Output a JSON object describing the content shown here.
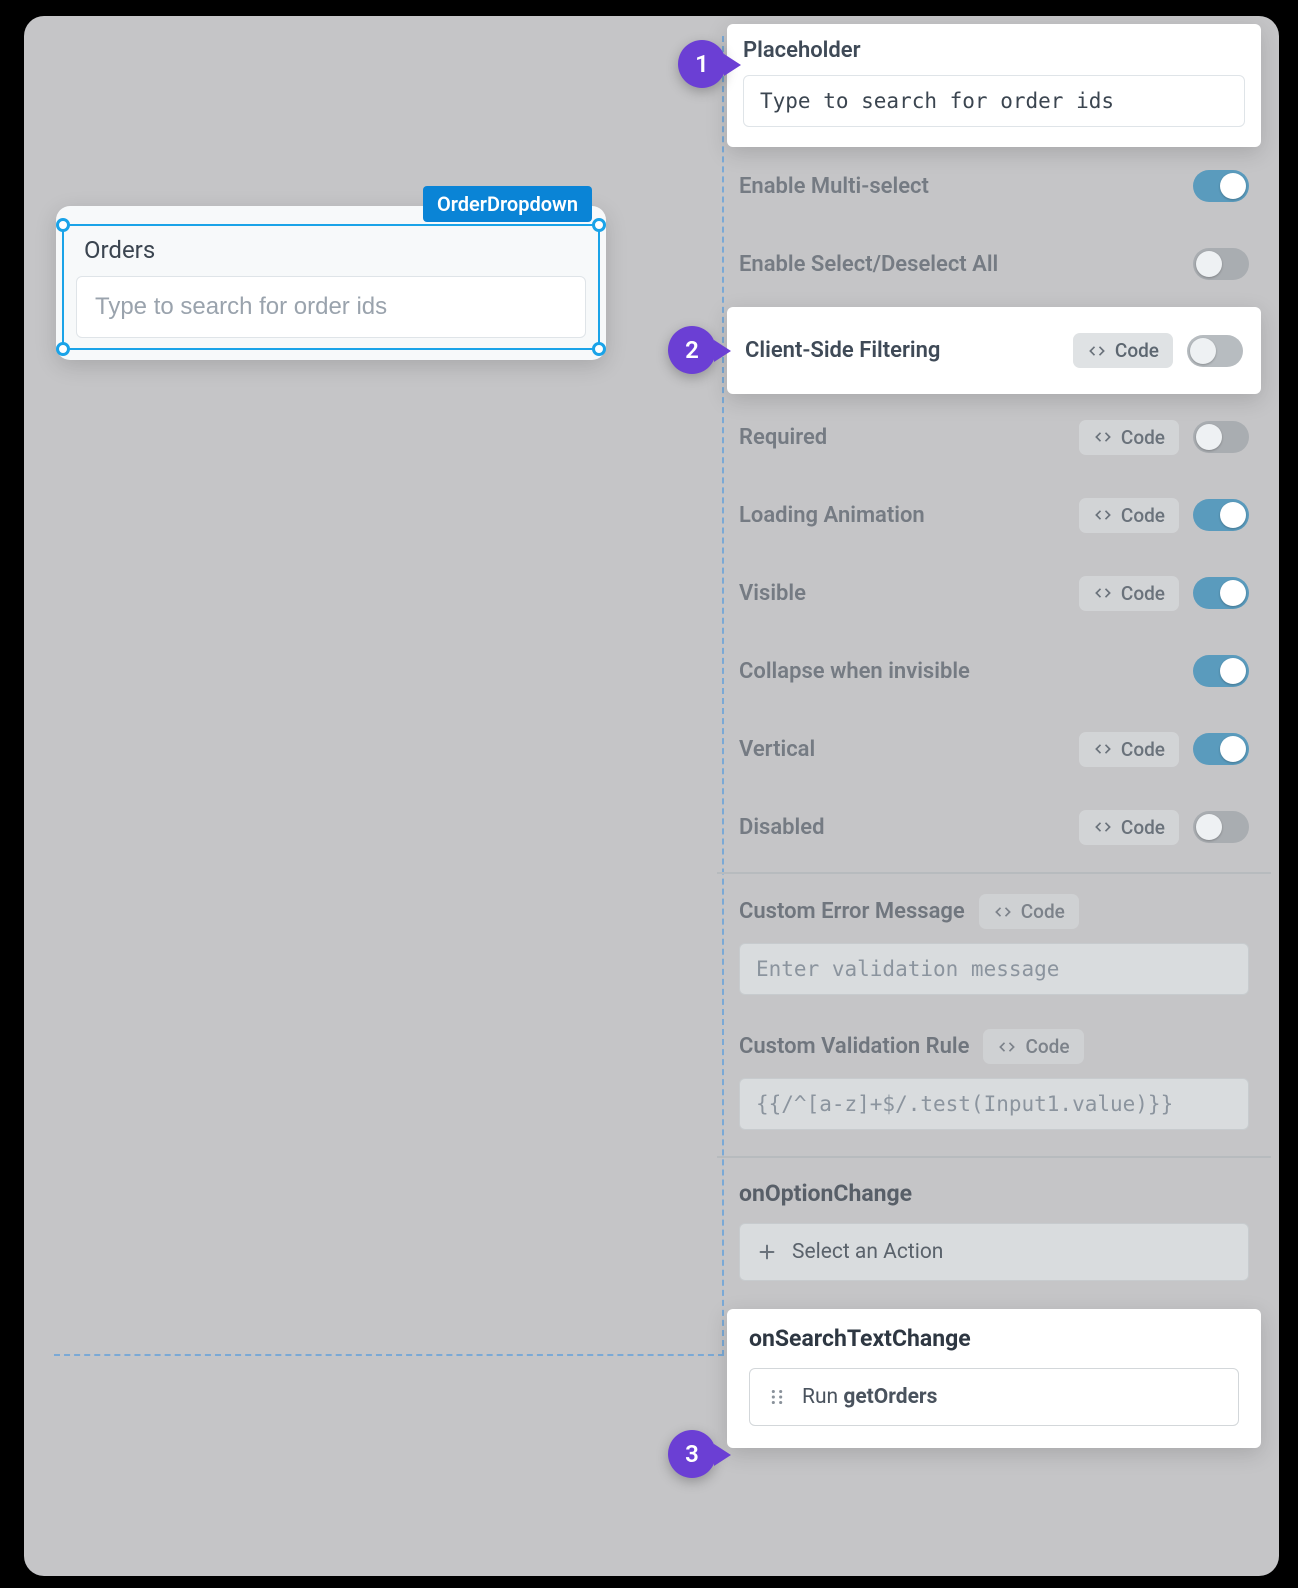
{
  "canvas": {
    "widget_tag": "OrderDropdown",
    "widget_label": "Orders",
    "widget_placeholder": "Type to search for order ids"
  },
  "panel": {
    "placeholder": {
      "label": "Placeholder",
      "value": "Type to search for order ids"
    },
    "code_pill": "Code",
    "rows": {
      "multi_select": {
        "label": "Enable Multi-select",
        "on": true
      },
      "select_all": {
        "label": "Enable Select/Deselect All",
        "on": false
      },
      "client_filter": {
        "label": "Client-Side Filtering",
        "on": false
      },
      "required": {
        "label": "Required",
        "on": false
      },
      "loading": {
        "label": "Loading Animation",
        "on": true
      },
      "visible": {
        "label": "Visible",
        "on": true
      },
      "collapse": {
        "label": "Collapse when invisible",
        "on": true
      },
      "vertical": {
        "label": "Vertical",
        "on": true
      },
      "disabled": {
        "label": "Disabled",
        "on": false
      }
    },
    "custom_error": {
      "label": "Custom Error Message",
      "placeholder": "Enter validation message"
    },
    "custom_rule": {
      "label": "Custom Validation Rule",
      "placeholder": "{{/^[a-z]+$/.test(Input1.value)}}"
    },
    "events": {
      "option_change": {
        "title": "onOptionChange",
        "action": "Select an Action"
      },
      "search_change": {
        "title": "onSearchTextChange",
        "action_prefix": "Run ",
        "action_name": "getOrders"
      }
    }
  },
  "callouts": {
    "1": "1",
    "2": "2",
    "3": "3"
  }
}
